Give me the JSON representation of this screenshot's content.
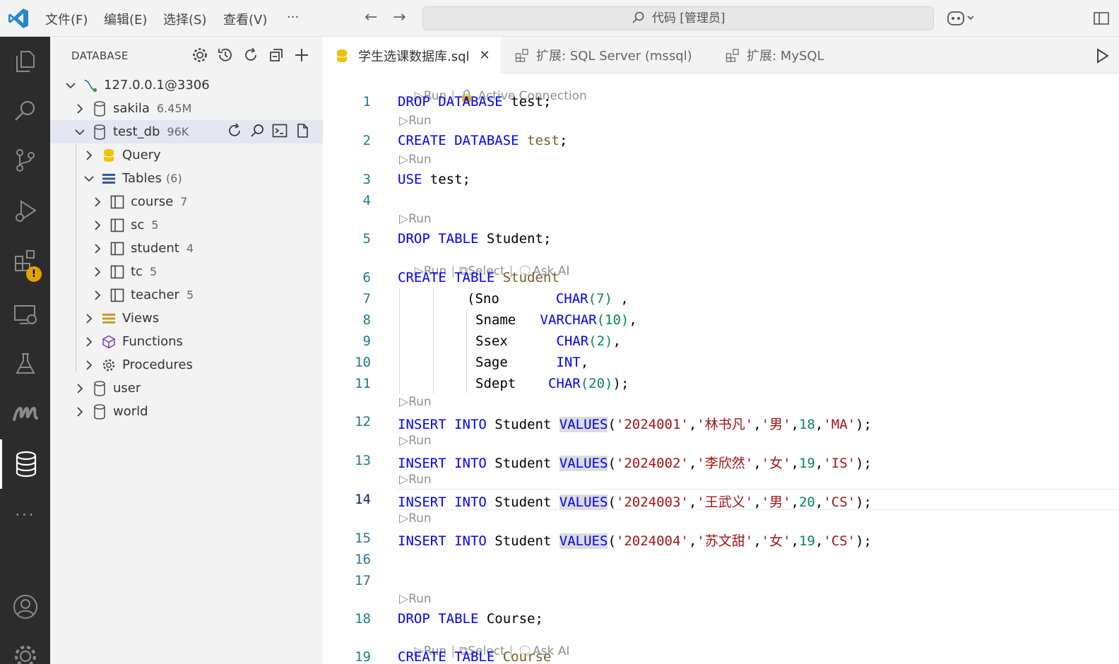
{
  "titlebar": {
    "menus": [
      "文件(F)",
      "编辑(E)",
      "选择(S)",
      "查看(V)",
      "···"
    ],
    "search_text": "代码 [管理员]"
  },
  "activity_icons": [
    "files-icon",
    "search-icon",
    "source-control-icon",
    "run-debug-icon",
    "extensions-icon",
    "remote-explorer-icon",
    "testing-icon",
    "mysql-icon",
    "database-icon",
    "more-icon",
    "account-icon",
    "settings-icon"
  ],
  "sidebar": {
    "title": "DATABASE",
    "connection": "127.0.0.1@3306",
    "databases": [
      {
        "name": "sakila",
        "size": "6.45M"
      },
      {
        "name": "test_db",
        "size": "96K"
      },
      {
        "name": "user",
        "size": ""
      },
      {
        "name": "world",
        "size": ""
      }
    ],
    "test_db_children": {
      "query": "Query",
      "tables_label": "Tables",
      "tables_count": "(6)",
      "tables": [
        {
          "name": "course",
          "count": "7"
        },
        {
          "name": "sc",
          "count": "5"
        },
        {
          "name": "student",
          "count": "4"
        },
        {
          "name": "tc",
          "count": "5"
        },
        {
          "name": "teacher",
          "count": "5"
        }
      ],
      "views": "Views",
      "functions": "Functions",
      "procedures": "Procedures"
    }
  },
  "tabs": [
    {
      "label": "学生选课数据库.sql",
      "active": true
    },
    {
      "label": "扩展: SQL Server (mssql)",
      "active": false
    },
    {
      "label": "扩展: MySQL",
      "active": false
    }
  ],
  "editor": {
    "lens_run": "Run",
    "lens_active_connection": "Active Connection",
    "lens_select": "Select",
    "lens_ask_ai": "Ask AI",
    "line_numbers": [
      "1",
      "2",
      "3",
      "4",
      "5",
      "6",
      "7",
      "8",
      "9",
      "10",
      "11",
      "12",
      "13",
      "14",
      "15",
      "16",
      "17",
      "18",
      "19"
    ],
    "lines": {
      "l1": {
        "kw": "DROP DATABASE",
        "rest": " test;"
      },
      "l2": {
        "kw": "CREATE DATABASE",
        "id": "test",
        "rest": ";"
      },
      "l3": {
        "kw": "USE",
        "rest": " test;"
      },
      "l5": {
        "kw": "DROP TABLE",
        "rest": " Student;"
      },
      "l6": {
        "kw": "CREATE TABLE",
        "id": "Student"
      },
      "l7": {
        "col": "(Sno",
        "type": "CHAR",
        "arg": "(7)",
        "tail": " ,"
      },
      "l8": {
        "col": "Sname",
        "type": "VARCHAR",
        "arg": "(10)",
        "tail": ","
      },
      "l9": {
        "col": "Ssex",
        "type": "CHAR",
        "arg": "(2)",
        "tail": ","
      },
      "l10": {
        "col": "Sage",
        "type": "INT",
        "tail": ","
      },
      "l11": {
        "col": "Sdept",
        "type": "CHAR",
        "arg": "(20)",
        "tail": ");"
      },
      "inserts": [
        {
          "id": "'2024001'",
          "name": "'林书凡'",
          "sex": "'男'",
          "age": "18",
          "dept": "'MA'"
        },
        {
          "id": "'2024002'",
          "name": "'李欣然'",
          "sex": "'女'",
          "age": "19",
          "dept": "'IS'"
        },
        {
          "id": "'2024003'",
          "name": "'王武义'",
          "sex": "'男'",
          "age": "20",
          "dept": "'CS'"
        },
        {
          "id": "'2024004'",
          "name": "'苏文甜'",
          "sex": "'女'",
          "age": "19",
          "dept": "'CS'"
        }
      ],
      "insert_kw": "INSERT INTO",
      "insert_table": " Student ",
      "values_kw": "VALUES",
      "l18": {
        "kw": "DROP TABLE",
        "rest": " Course;"
      },
      "l19": {
        "kw": "CREATE TABLE",
        "id": "Course"
      }
    }
  }
}
